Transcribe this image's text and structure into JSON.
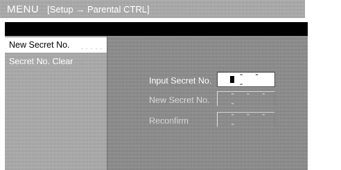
{
  "header": {
    "title": "MENU",
    "path": "[Setup → Parental CTRL]"
  },
  "sidebar": {
    "items": [
      {
        "label": "New Secret No."
      },
      {
        "label": "Secret No. Clear"
      }
    ]
  },
  "form": {
    "rows": [
      {
        "label": "Input Secret No.",
        "value": "- - -"
      },
      {
        "label": "New Secret No.",
        "value": "- - - -"
      },
      {
        "label": "Reconfirm",
        "value": "- - - -"
      }
    ]
  }
}
